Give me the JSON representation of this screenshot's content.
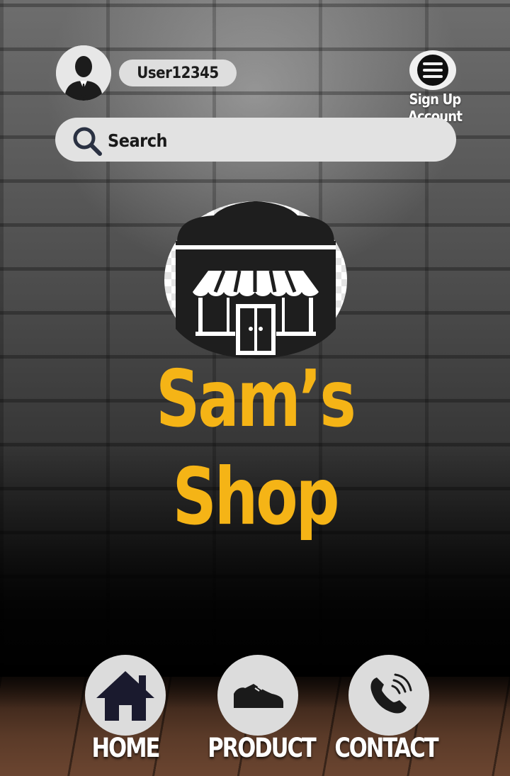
{
  "header": {
    "username": "User12345",
    "menu_label": "Sign Up Account"
  },
  "search": {
    "placeholder": "Search"
  },
  "brand": {
    "title": "Sam’s Shop"
  },
  "nav": [
    {
      "label": "HOME",
      "icon": "home-icon"
    },
    {
      "label": "PRODUCT",
      "icon": "shoe-icon"
    },
    {
      "label": "CONTACT",
      "icon": "phone-icon"
    }
  ],
  "colors": {
    "brand": "#f5b416",
    "pill": "#dedede",
    "icon_dark": "#1a1a2e"
  }
}
